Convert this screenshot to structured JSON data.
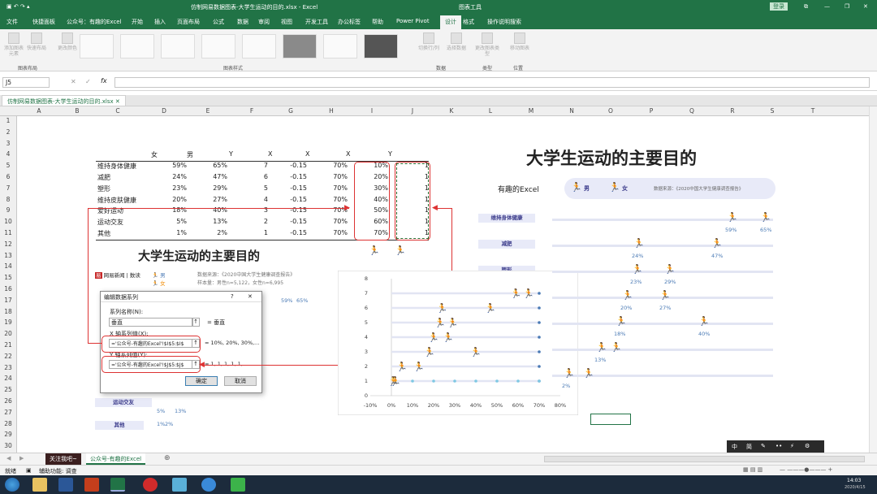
{
  "window": {
    "title": "仿制网易数据图表-大学生运动的目的.xlsx - Excel",
    "chart_tools": "图表工具",
    "login": "登录",
    "share": "共享"
  },
  "ribbon_tabs": [
    "文件",
    "快捷面板",
    "公众号：有趣的Excel",
    "开始",
    "插入",
    "页面布局",
    "公式",
    "数据",
    "审阅",
    "视图",
    "开发工具",
    "办公标签",
    "帮助",
    "Power Pivot",
    "设计",
    "格式",
    "操作说明搜索"
  ],
  "ribbon": {
    "add_element": "添加图表元素",
    "quick_layout": "快速布局",
    "change_colors": "更改颜色",
    "switch_rowcol": "切换行/列",
    "select_data": "选择数据",
    "change_type": "更改图表类型",
    "move_chart": "移动图表",
    "groups": [
      "图表布局",
      "图表样式",
      "数据",
      "类型",
      "位置"
    ]
  },
  "formula_bar": {
    "name_box": "J5",
    "fx": "fx",
    "cancel": "✕",
    "enter": "✓"
  },
  "workbook_tab": "仿制网易数据图表-大学生运动的目的.xlsx",
  "columns": [
    "A",
    "B",
    "C",
    "D",
    "E",
    "F",
    "G",
    "H",
    "I",
    "J",
    "K",
    "L",
    "M",
    "N",
    "O",
    "P",
    "Q",
    "R",
    "S",
    "T"
  ],
  "rows": [
    "1",
    "2",
    "3",
    "4",
    "5",
    "6",
    "7",
    "8",
    "9",
    "10",
    "11",
    "12",
    "13",
    "14",
    "15",
    "16",
    "17",
    "18",
    "19",
    "20",
    "21",
    "22",
    "23",
    "24",
    "25",
    "26",
    "27",
    "28",
    "29",
    "30",
    "31"
  ],
  "table": {
    "headers": [
      "女",
      "男",
      "Y",
      "X",
      "X",
      "X",
      "Y"
    ],
    "rows": [
      {
        "label": "维持身体健康",
        "f": "59%",
        "m": "65%",
        "y": "7",
        "x1": "-0.15",
        "x2": "70%",
        "x3": "10%",
        "y2": "1"
      },
      {
        "label": "减肥",
        "f": "24%",
        "m": "47%",
        "y": "6",
        "x1": "-0.15",
        "x2": "70%",
        "x3": "20%",
        "y2": "1"
      },
      {
        "label": "塑形",
        "f": "23%",
        "m": "29%",
        "y": "5",
        "x1": "-0.15",
        "x2": "70%",
        "x3": "30%",
        "y2": "1"
      },
      {
        "label": "维持皮肤健康",
        "f": "20%",
        "m": "27%",
        "y": "4",
        "x1": "-0.15",
        "x2": "70%",
        "x3": "40%",
        "y2": "1"
      },
      {
        "label": "爱好运动",
        "f": "18%",
        "m": "40%",
        "y": "3",
        "x1": "-0.15",
        "x2": "70%",
        "x3": "50%",
        "y2": "1"
      },
      {
        "label": "运动交友",
        "f": "5%",
        "m": "13%",
        "y": "2",
        "x1": "-0.15",
        "x2": "70%",
        "x3": "60%",
        "y2": "1"
      },
      {
        "label": "其他",
        "f": "1%",
        "m": "2%",
        "y": "1",
        "x1": "-0.15",
        "x2": "70%",
        "x3": "70%",
        "y2": "1"
      }
    ]
  },
  "ref_image": {
    "title": "大学生运动的主要目的",
    "brand": "网易新闻 | 数读",
    "male": "男",
    "female": "女",
    "source": "数据来源：《2020中国大学生健康调查报告》",
    "sample": "样本量：男性n=5,122，女性n=6,995",
    "pcts": [
      "59%",
      "65%",
      "5%",
      "13%",
      "1%",
      "2%"
    ],
    "cats": [
      "运动交友",
      "其他"
    ]
  },
  "dialog": {
    "title": "编辑数据系列",
    "help": "?",
    "close": "✕",
    "name_label": "系列名称(N):",
    "name_value": "垂直",
    "name_eq": "= 垂直",
    "x_label": "X 轴系列值(X):",
    "x_value": "='公众号-有趣的Excel'!$I$5:$I$",
    "x_eq": "= 10%, 20%, 30%,...",
    "y_label": "Y 轴系列值(Y):",
    "y_value": "='公众号-有趣的Excel'!$J$5:$J$",
    "y_eq": "= 1, 1, 1, 1, 1,...",
    "ok": "确定",
    "cancel": "取消"
  },
  "chart_data": {
    "type": "scatter",
    "title": "",
    "xlim": [
      -0.1,
      0.8
    ],
    "ylim": [
      0,
      8
    ],
    "xticks": [
      "-10%",
      "0%",
      "10%",
      "20%",
      "30%",
      "40%",
      "50%",
      "60%",
      "70%",
      "80%"
    ],
    "yticks": [
      "0",
      "1",
      "2",
      "3",
      "4",
      "5",
      "6",
      "7",
      "8"
    ],
    "grid": false,
    "series": [
      {
        "name": "女",
        "x": [
          0.59,
          0.24,
          0.23,
          0.2,
          0.18,
          0.05,
          0.01
        ],
        "y": [
          7,
          6,
          5,
          4,
          3,
          2,
          1
        ],
        "color": "#f08a00"
      },
      {
        "name": "男",
        "x": [
          0.65,
          0.47,
          0.29,
          0.27,
          0.4,
          0.13,
          0.02
        ],
        "y": [
          7,
          6,
          5,
          4,
          3,
          2,
          1
        ],
        "color": "#1f6fb5"
      },
      {
        "x": [
          -0.15,
          -0.15,
          -0.15,
          -0.15,
          -0.15,
          -0.15,
          -0.15
        ],
        "y": [
          7,
          6,
          5,
          4,
          3,
          2,
          1
        ],
        "color": "#dfe3f3"
      },
      {
        "x": [
          0.7,
          0.7,
          0.7,
          0.7,
          0.7,
          0.7,
          0.7
        ],
        "y": [
          7,
          6,
          5,
          4,
          3,
          2,
          1
        ],
        "color": "#4a7ab5"
      },
      {
        "name": "垂直",
        "x": [
          0.1,
          0.2,
          0.3,
          0.4,
          0.5,
          0.6,
          0.7
        ],
        "y": [
          1,
          1,
          1,
          1,
          1,
          1,
          1
        ],
        "color": "#7ec8e3"
      }
    ]
  },
  "right_chart": {
    "title": "大学生运动的主要目的",
    "subtitle": "有趣的Excel",
    "male": "男",
    "female": "女",
    "source": "数据来源：《2020中国大学生健康调查报告》",
    "cats": [
      "维持身体健康",
      "减肥",
      "塑形"
    ],
    "pcts_f": [
      "59%",
      "24%",
      "23%",
      "20%",
      "18%",
      "13%",
      "2%"
    ],
    "pcts_m": [
      "65%",
      "47%",
      "29%",
      "27%",
      "40%"
    ]
  },
  "sheet_tabs": [
    "关注我吧~",
    "公众号-有趣的Excel"
  ],
  "status": {
    "ready": "就绪",
    "access": "辅助功能: 调查"
  },
  "float_toolbar": [
    "中",
    "简",
    "✎",
    "••",
    "⚡",
    "⚙"
  ],
  "clock": {
    "time": "14:03",
    "date": "2020/4/15"
  }
}
